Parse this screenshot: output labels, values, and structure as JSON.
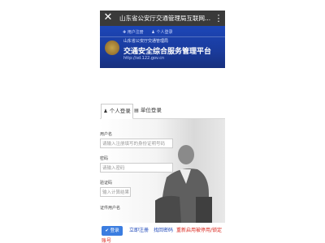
{
  "topbar": {
    "close_icon": "close-icon",
    "title": "山东省公安厅交通管理局互联网...",
    "more_icon": "more-vertical-icon"
  },
  "banner": {
    "register_link": "✚ 用户注册",
    "login_link": "♟ 个人登录",
    "org_name": "山东省公安厅交通管理局",
    "title": "交通安全综合服务管理平台",
    "url": "http://sd.122.gov.cn"
  },
  "tabs": [
    {
      "label": "个人登录",
      "icon": "user-icon",
      "active": true
    },
    {
      "label": "单位登录",
      "icon": "building-icon",
      "active": false
    }
  ],
  "form": {
    "username_label": "用户名",
    "username_placeholder": "请输入注册填写的身份证明号码",
    "password_label": "密码",
    "password_placeholder": "请输入密码",
    "captcha_label": "验证码",
    "captcha_placeholder": "输入计算结果",
    "cert_label": "证件用户名"
  },
  "actions": {
    "login_button": "✔ 登录",
    "register_link": "立即注册",
    "recover_password_link": "找回密码",
    "reactivate_link": "重新启用被停用/锁定",
    "overflow_text": "账号"
  },
  "colors": {
    "banner_blue": "#1c46b8",
    "link_red": "#d9241b",
    "button_blue": "#3b7de0",
    "topbar": "#3a3a3a"
  }
}
